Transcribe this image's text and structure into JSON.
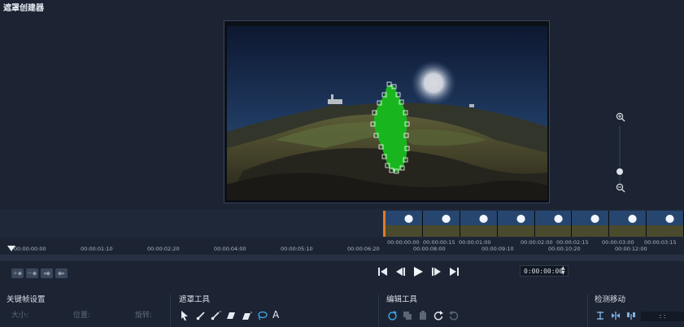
{
  "app": {
    "title": "遮罩创建器"
  },
  "timeline": {
    "ruler_labels": [
      "00:00:00:00",
      "00:00:01:10",
      "00:00:02:20",
      "00:00:04:00",
      "00:00:05:10",
      "00:00:06:20"
    ],
    "clip_labels_top": [
      "00:00:00:00",
      "00:00:00:15",
      "00:00:01:00",
      "00:00:02:00",
      "00:00:02:15",
      "00:00:03:00",
      "00:00:03:15"
    ],
    "clip_labels_bottom": [
      "00:00:08:00",
      "00:00:09:10",
      "00:00:10:20",
      "00:00:12:00"
    ]
  },
  "playback": {
    "timecode": "0:00:00:00"
  },
  "panels": {
    "keyframe": {
      "title": "关键帧设置",
      "size_label": "大小:",
      "position_label": "位置:",
      "rotation_label": "旋转:"
    },
    "mask_tools": {
      "title": "遮罩工具",
      "text_tool_glyph": "A"
    },
    "edit_tools": {
      "title": "编辑工具"
    },
    "motion": {
      "title": "检测移动",
      "field_value": ": :"
    }
  },
  "colors": {
    "background": "#1c2434",
    "mask": "#19b51e",
    "clip_accent": "#e07a2a"
  }
}
